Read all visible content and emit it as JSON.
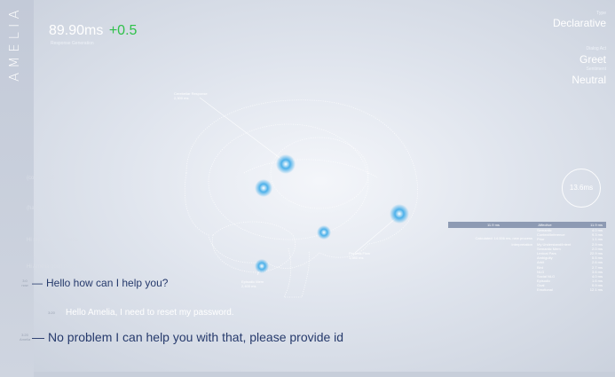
{
  "brand": {
    "name": "AMELIA"
  },
  "latency": {
    "value": "89.90ms",
    "delta": "+0.5",
    "caption": "Response Generation"
  },
  "classification": {
    "type_label": "Type",
    "type_value": "Declarative",
    "intent_label": "Dialog Act",
    "intent_value": "Greet",
    "sentiment_label": "Sentiment",
    "sentiment_value": "Neutral"
  },
  "brain_labels": [
    {
      "text": "Cerebellar Response\n2,300 ms"
    },
    {
      "text": "Process Flow\n1,980 ms"
    },
    {
      "text": "Episodic Mem\n2,400 ms"
    }
  ],
  "timer": {
    "value": "13.6ms"
  },
  "metrics_table": {
    "head_left": "11.9 ms",
    "head_mid": "Affective",
    "head_right": "11.9 ms",
    "rows": [
      {
        "k": "Semantic",
        "v": "4.0 ms"
      },
      {
        "k": "Context/Inference",
        "v": "9.3 ms"
      },
      {
        "k": "Prior",
        "v": "1.1 ms"
      },
      {
        "k": "My Understand/Intent",
        "v": "2.9 ms"
      },
      {
        "k": "Semantic Mem",
        "v": "2.0 ms"
      },
      {
        "k": "Lexical Pars",
        "v": "22.9 ms"
      },
      {
        "k": "Ambiguity",
        "v": "5.5 ms"
      },
      {
        "k": "Arbit",
        "v": "2.6 ms"
      },
      {
        "k": "Bird",
        "v": "2.7 ms"
      },
      {
        "k": "NLG",
        "v": "3.6 ms"
      },
      {
        "k": "Social NLG",
        "v": "4.0 ms"
      },
      {
        "k": "Episodic",
        "v": "1.6 ms"
      },
      {
        "k": "Goal",
        "v": "0.9 ms"
      },
      {
        "k": "Emotional",
        "v": "12.1 ms"
      }
    ],
    "notes": [
      "Calculated: 14.006 ms, new process",
      "Interpretation"
    ]
  },
  "history_faded": [
    "(connected)",
    "(handoff)",
    "Hi my name is Amelia",
    "Hi Amelia good morning"
  ],
  "conversation": [
    {
      "time": "3:0\nnow",
      "text": "Hello how can I help you?"
    },
    {
      "time": "3:20",
      "text": "Hello Amelia, I need to reset my password."
    },
    {
      "time": "3:20\nAmelia",
      "text": "No problem I can help you with that, please provide id"
    }
  ]
}
